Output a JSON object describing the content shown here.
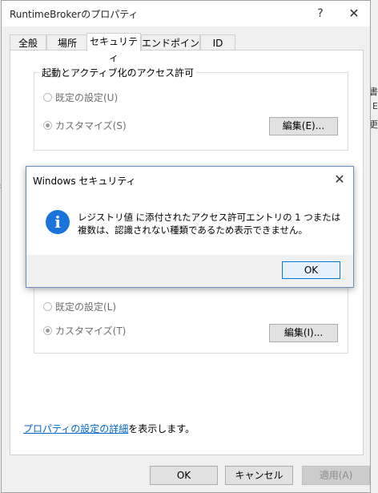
{
  "window": {
    "title": "RuntimeBrokerのプロパティ",
    "help": "?",
    "close": "✕"
  },
  "tabs": [
    {
      "label": "全般"
    },
    {
      "label": "場所"
    },
    {
      "label": "セキュリティ"
    },
    {
      "label": "エンドポイント"
    },
    {
      "label": "ID"
    }
  ],
  "launch_group": {
    "label": "起動とアクティブ化のアクセス許可",
    "options": [
      {
        "label": "既定の設定(U)",
        "checked": false
      },
      {
        "label": "カスタマイズ(S)",
        "checked": true
      }
    ],
    "edit_button": "編集(E)..."
  },
  "config_group": {
    "options": [
      {
        "label": "既定の設定(L)",
        "checked": false
      },
      {
        "label": "カスタマイズ(T)",
        "checked": true
      }
    ],
    "edit_button": "編集(I)..."
  },
  "footer": {
    "link_text": "プロパティの設定の詳細",
    "link_suffix": "を表示します。"
  },
  "buttons": {
    "ok": "OK",
    "cancel": "キャンセル",
    "apply": "適用(A)"
  },
  "alert": {
    "title": "Windows セキュリティ",
    "close": "✕",
    "icon": "i",
    "message": "レジストリ値 に添付されたアクセス許可エントリの 1 つまたは複数は、認識されない種類であるため表示できません。",
    "ok": "OK",
    "accent": "#0078d7"
  },
  "background": {
    "left_fragments": [
      "ン",
      "s"
    ],
    "right_fragments": [
      "書",
      "E",
      "更"
    ]
  }
}
